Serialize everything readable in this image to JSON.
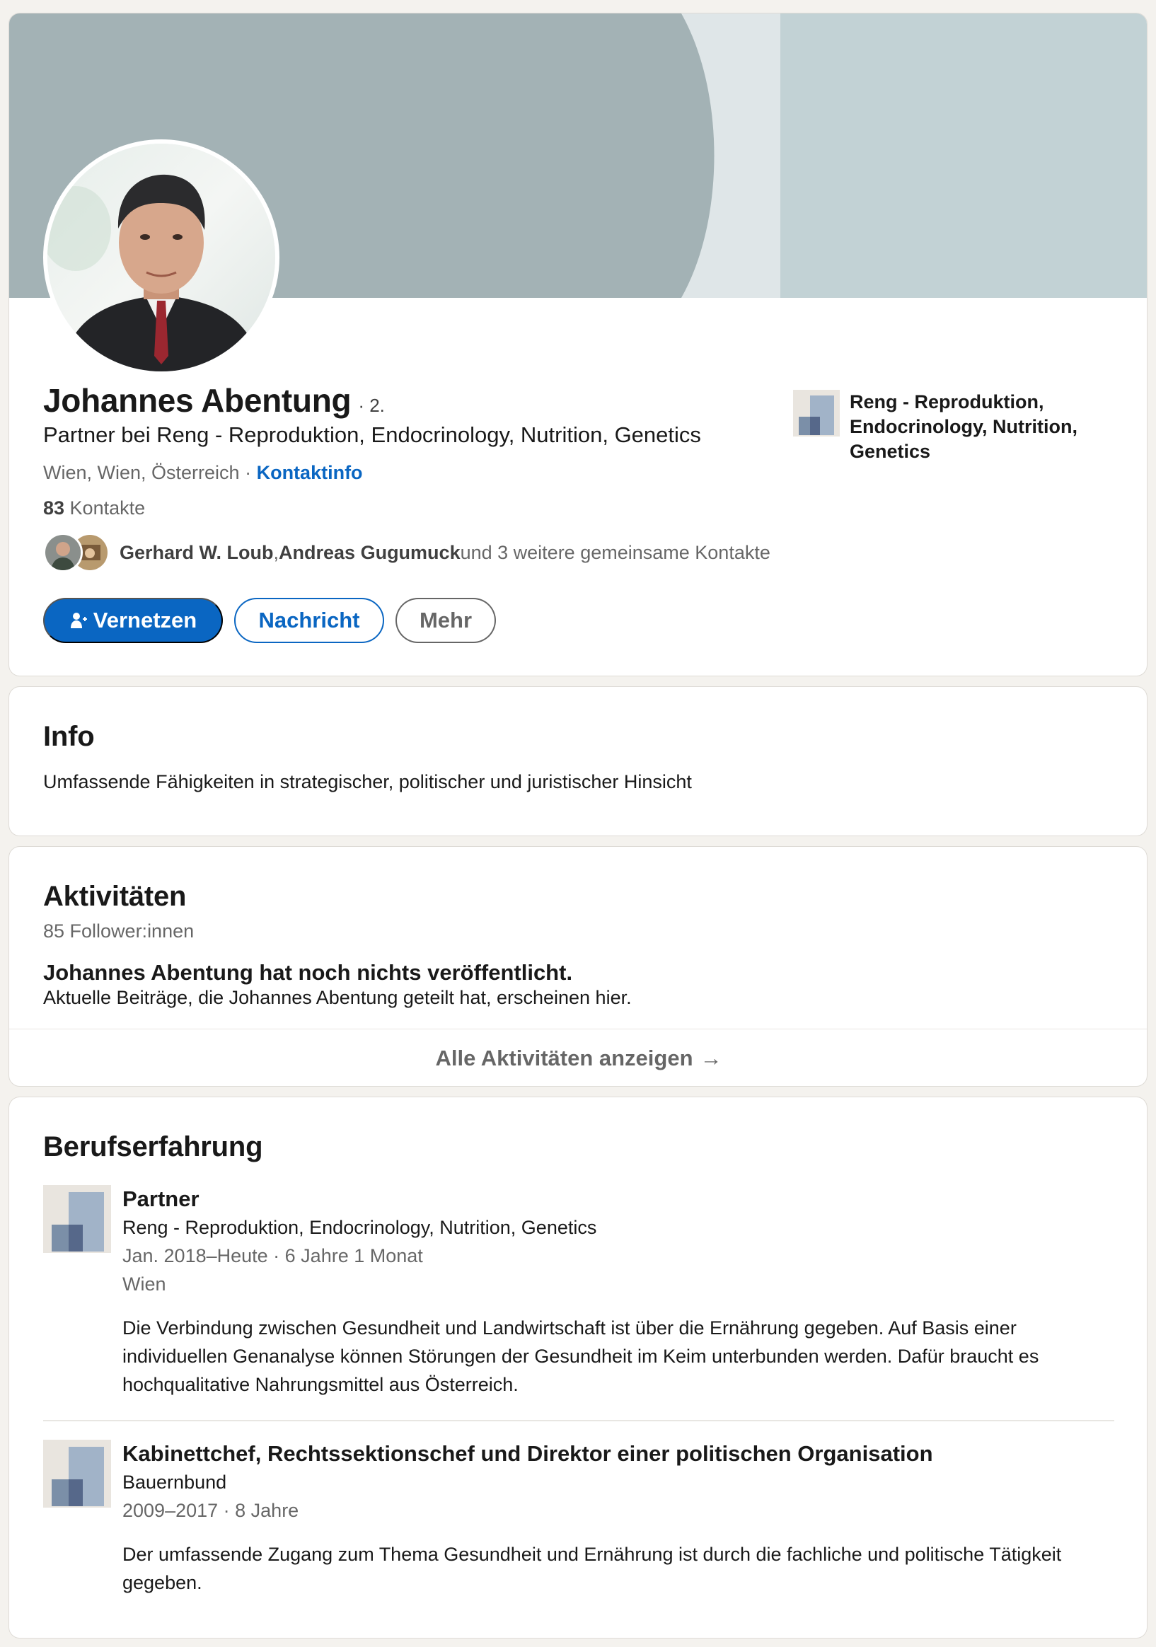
{
  "profile": {
    "name": "Johannes Abentung",
    "degree": "· 2.",
    "headline": "Partner bei Reng - Reproduktion, Endocrinology, Nutrition, Genetics",
    "location": "Wien, Wien, Österreich",
    "location_sep": " · ",
    "contact_link": "Kontaktinfo",
    "connections_count": "83",
    "connections_label": " Kontakte",
    "mutual": {
      "name1": "Gerhard W. Loub",
      "sep": ", ",
      "name2": "Andreas Gugumuck",
      "rest": " und 3 weitere gemeinsame Kontakte"
    },
    "current_company": "Reng - Reproduktion, Endocrinology, Nutrition, Genetics"
  },
  "actions": {
    "connect": "Vernetzen",
    "message": "Nachricht",
    "more": "Mehr"
  },
  "info": {
    "title": "Info",
    "text": "Umfassende Fähigkeiten in strategischer, politischer und juristischer Hinsicht"
  },
  "activity": {
    "title": "Aktivitäten",
    "followers": "85 Follower:innen",
    "empty_title": "Johannes Abentung hat noch nichts veröffentlicht.",
    "empty_sub": "Aktuelle Beiträge, die Johannes Abentung geteilt hat, erscheinen hier.",
    "show_all": "Alle Aktivitäten anzeigen",
    "arrow": "→"
  },
  "experience": {
    "title": "Berufserfahrung",
    "items": [
      {
        "title": "Partner",
        "company": "Reng - Reproduktion, Endocrinology, Nutrition, Genetics",
        "dates": "Jan. 2018–Heute · 6 Jahre 1 Monat",
        "location": "Wien",
        "description": "Die Verbindung zwischen Gesundheit und Landwirtschaft ist über die Ernährung gegeben. Auf Basis einer individuellen Genanalyse können Störungen der Gesundheit im Keim unterbunden werden. Dafür braucht es hochqualitative Nahrungsmittel aus Österreich."
      },
      {
        "title": "Kabinettchef, Rechtssektionschef und Direktor einer politischen Organisation",
        "company": "Bauernbund",
        "dates": "2009–2017 · 8 Jahre",
        "description": "Der umfassende Zugang zum Thema Gesundheit und Ernährung ist durch die fachliche und politische Tätigkeit gegeben."
      }
    ]
  },
  "icons": {
    "connect": "person-add-icon",
    "company_logo": "company-placeholder-icon",
    "arrow": "arrow-right-icon"
  },
  "colors": {
    "brand": "#0a66c2",
    "background": "#f4f2ee",
    "banner": "#a3b2b5"
  }
}
